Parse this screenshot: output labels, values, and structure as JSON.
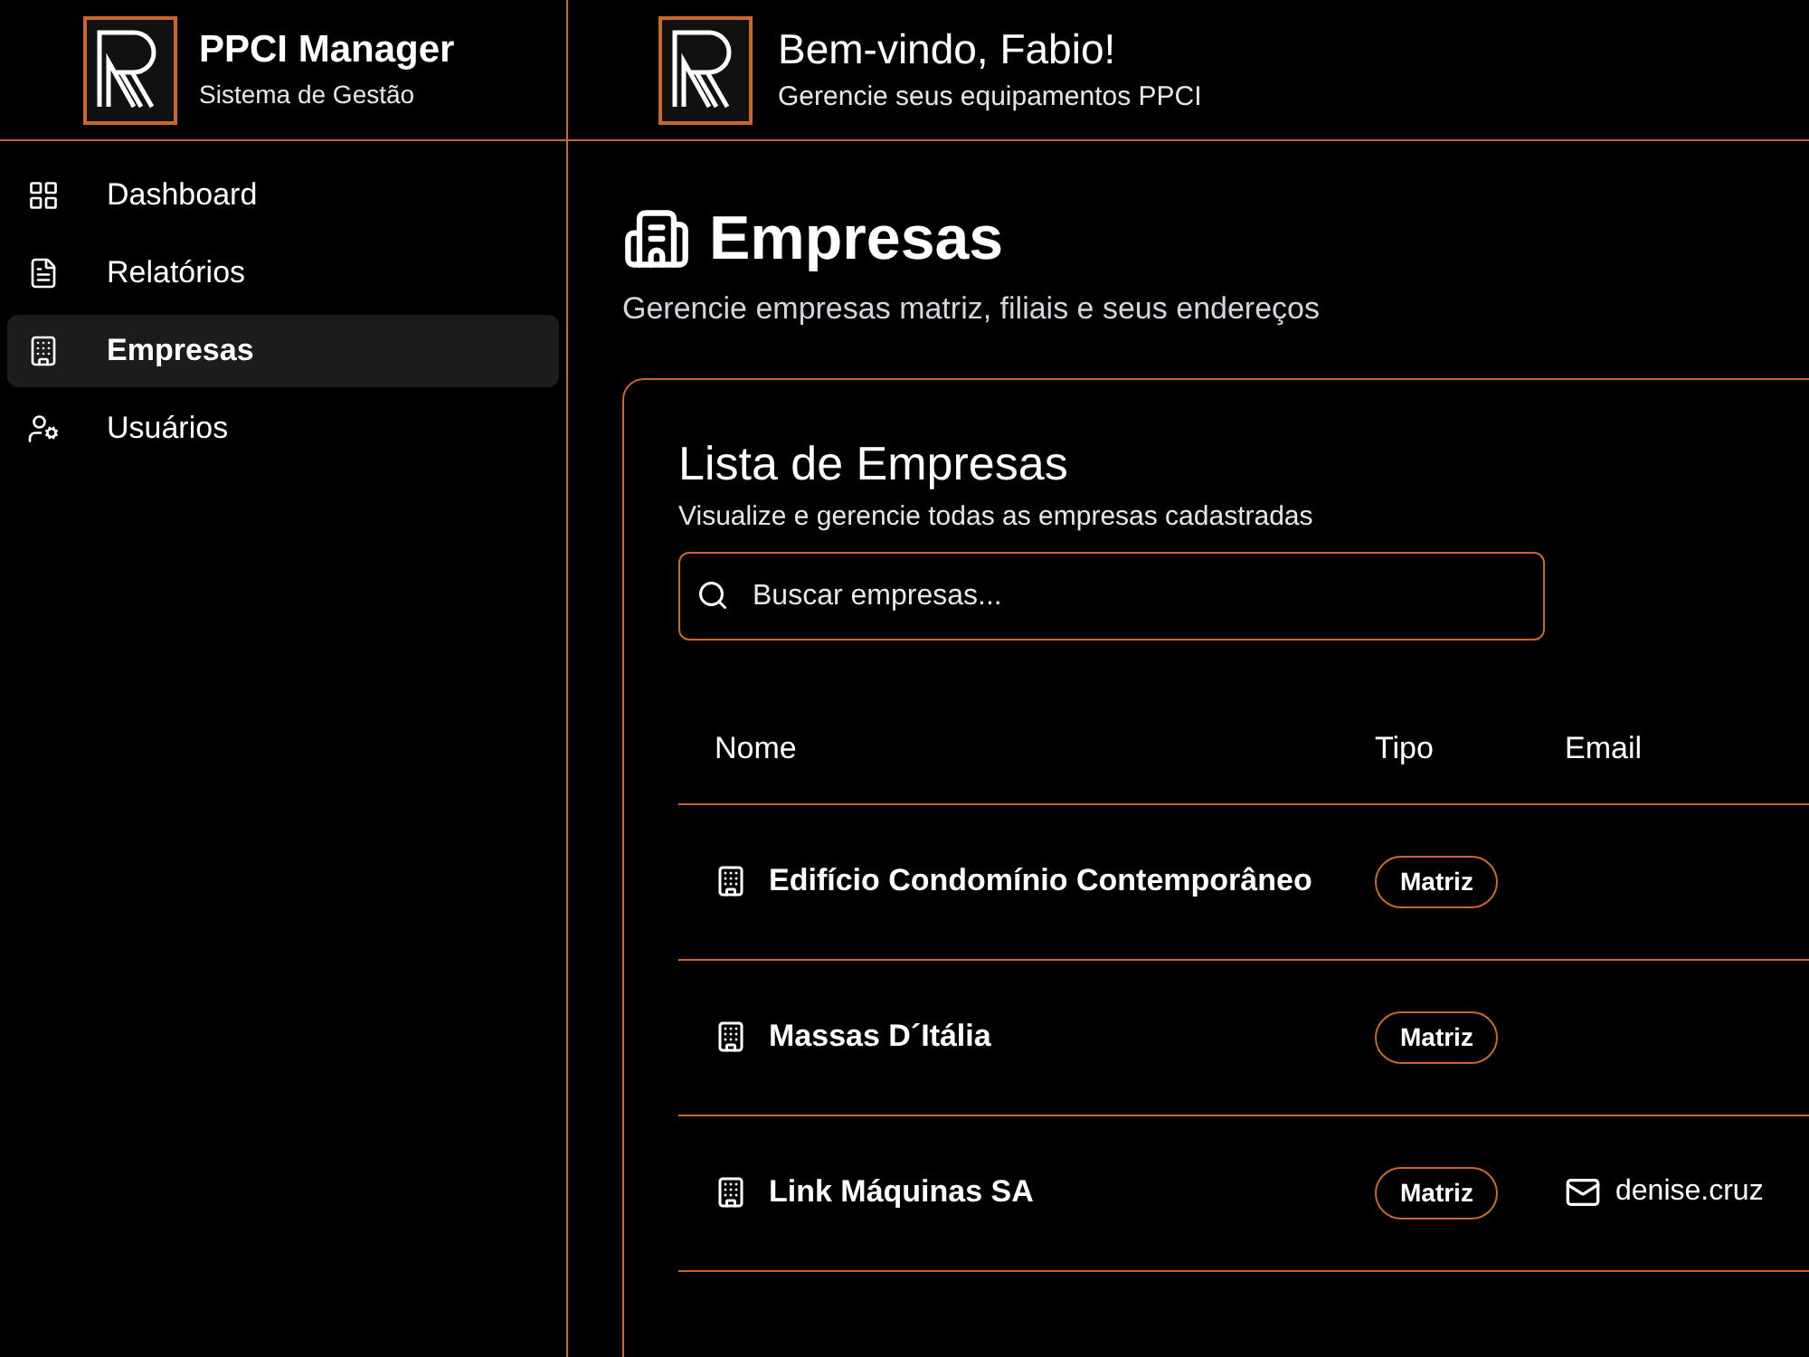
{
  "sidebar": {
    "app_name": "PPCI Manager",
    "app_subtitle": "Sistema de Gestão",
    "items": [
      {
        "label": "Dashboard",
        "selected": false
      },
      {
        "label": "Relatórios",
        "selected": false
      },
      {
        "label": "Empresas",
        "selected": true
      },
      {
        "label": "Usuários",
        "selected": false
      }
    ]
  },
  "header": {
    "title": "Bem-vindo, Fabio!",
    "subtitle": "Gerencie seus equipamentos PPCI"
  },
  "page": {
    "title": "Empresas",
    "subtitle": "Gerencie empresas matriz, filiais e seus endereços"
  },
  "card": {
    "title": "Lista de Empresas",
    "subtitle": "Visualize e gerencie todas as empresas cadastradas",
    "search": {
      "placeholder": "Buscar empresas..."
    },
    "table": {
      "columns": [
        "Nome",
        "Tipo",
        "Email"
      ],
      "rows": [
        {
          "name": "Edifício Condomínio Contemporâneo",
          "type": "Matriz"
        },
        {
          "name": "Massas D´Itália",
          "type": "Matriz"
        },
        {
          "name": "Link Máquinas SA",
          "type": "Matriz",
          "email": "denise.cruz"
        }
      ]
    }
  }
}
